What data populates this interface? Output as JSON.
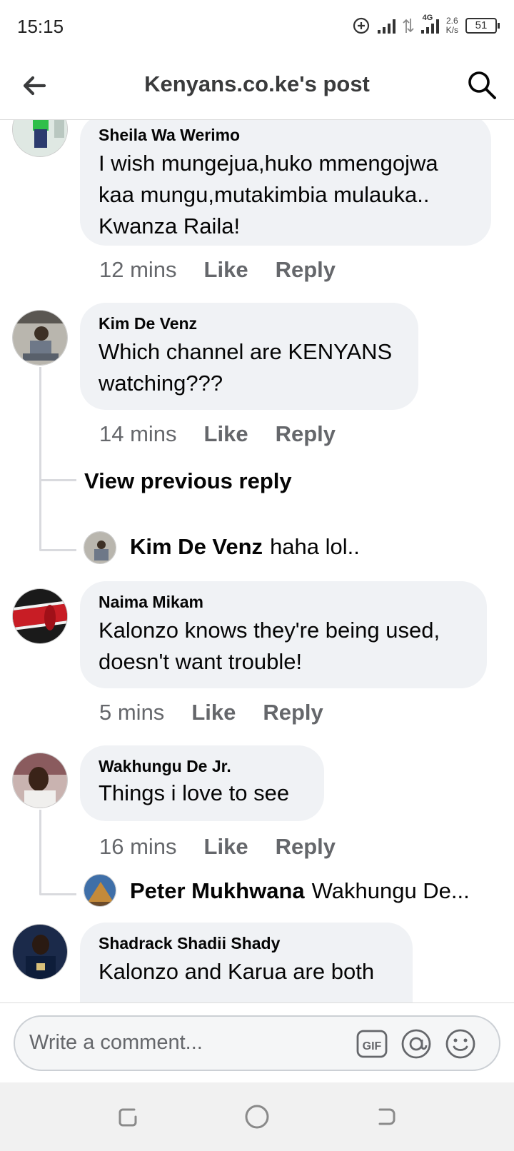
{
  "status_bar": {
    "time": "15:15",
    "network": "4G",
    "speed_value": "2.6",
    "speed_unit": "K/s",
    "battery": "51"
  },
  "header": {
    "title": "Kenyans.co.ke's post",
    "back_icon": "arrow-left-icon",
    "search_icon": "search-icon"
  },
  "comments": [
    {
      "name": "Sheila Wa Werimo",
      "text_lines": [
        "I wish mungejua,huko mmengojwa",
        "kaa mungu,mutakimbia mulauka..",
        "Kwanza Raila!"
      ],
      "time": "12 mins",
      "like": "Like",
      "reply": "Reply"
    },
    {
      "name": "Kim De Venz",
      "text_lines": [
        "Which channel are KENYANS",
        "watching???"
      ],
      "time": "14 mins",
      "like": "Like",
      "reply": "Reply",
      "view_previous": "View previous reply",
      "reply_preview": {
        "name": "Kim De Venz",
        "text": "haha lol.."
      }
    },
    {
      "name": "Naima Mikam",
      "text_lines": [
        "Kalonzo knows they're being used,",
        "doesn't want trouble!"
      ],
      "time": "5 mins",
      "like": "Like",
      "reply": "Reply"
    },
    {
      "name": "Wakhungu De Jr.",
      "text_lines": [
        "Things i love to see"
      ],
      "time": "16 mins",
      "like": "Like",
      "reply": "Reply",
      "reply_preview": {
        "name": "Peter Mukhwana",
        "text": "Wakhungu De..."
      }
    },
    {
      "name": "Shadrack Shadii Shady",
      "text_lines": [
        "Kalonzo and Karua are both"
      ]
    }
  ],
  "composer": {
    "placeholder": "Write a comment...",
    "gif_label": "GIF"
  },
  "colors": {
    "bubble": "#f0f2f5",
    "secondary_text": "#65676b",
    "primary_text": "#050505"
  }
}
